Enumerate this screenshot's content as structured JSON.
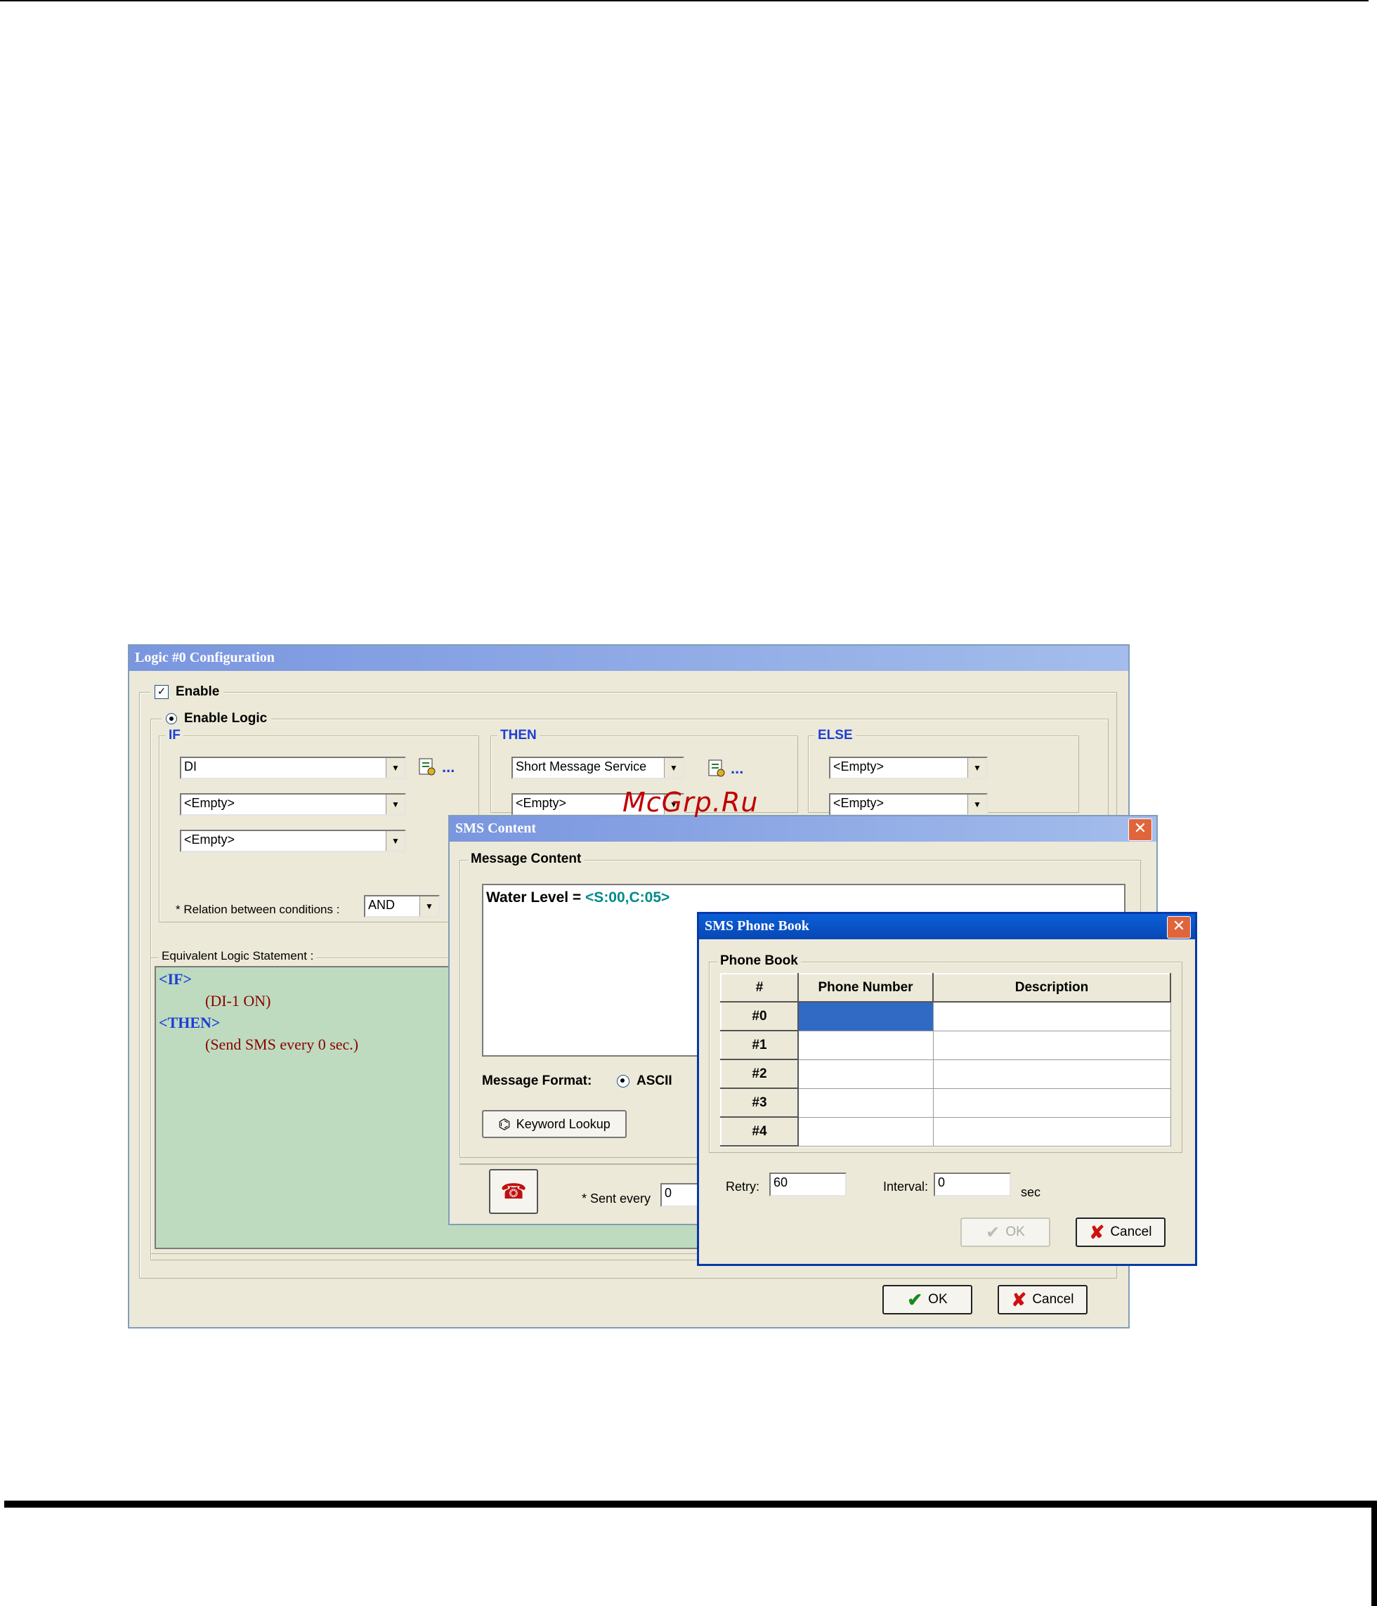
{
  "watermark": "McGrp.Ru",
  "logic_window": {
    "title": "Logic #0 Configuration",
    "enable_label": "Enable",
    "enable_logic_label": "Enable Logic",
    "if_group": {
      "legend": "IF",
      "combos": [
        "DI",
        "<Empty>",
        "<Empty>"
      ],
      "dots": "..."
    },
    "then_group": {
      "legend": "THEN",
      "combos": [
        "Short Message Service",
        "<Empty>"
      ],
      "dots": "..."
    },
    "else_group": {
      "legend": "ELSE",
      "combos": [
        "<Empty>",
        "<Empty>"
      ]
    },
    "relation_label": "* Relation between conditions :",
    "relation_value": "AND",
    "equivalent_legend": "Equivalent Logic Statement :",
    "statement": {
      "if_tag": "<IF>",
      "if_body": "(DI-1 ON)",
      "then_tag": "<THEN>",
      "then_body": "(Send SMS every 0 sec.)"
    },
    "ok_label": "OK",
    "cancel_label": "Cancel"
  },
  "sms_content_window": {
    "title": "SMS Content",
    "close_glyph": "✕",
    "message_legend": "Message Content",
    "message_prefix": "Water Level = ",
    "message_token": "<S:00,C:05>",
    "format_label": "Message Format:",
    "format_option": "ASCII",
    "keyword_button": "Keyword Lookup",
    "sent_every_label": "* Sent every",
    "sent_every_value": "0"
  },
  "phonebook_window": {
    "title": "SMS Phone Book",
    "close_glyph": "✕",
    "legend": "Phone Book",
    "columns": [
      "#",
      "Phone Number",
      "Description"
    ],
    "rows": [
      {
        "id": "#0",
        "phone": "",
        "desc": ""
      },
      {
        "id": "#1",
        "phone": "",
        "desc": ""
      },
      {
        "id": "#2",
        "phone": "",
        "desc": ""
      },
      {
        "id": "#3",
        "phone": "",
        "desc": ""
      },
      {
        "id": "#4",
        "phone": "",
        "desc": ""
      }
    ],
    "selected_row": 0,
    "retry_label": "Retry:",
    "retry_value": "60",
    "interval_label": "Interval:",
    "interval_value": "0",
    "sec_label": "sec",
    "ok_label": "OK",
    "cancel_label": "Cancel"
  },
  "colors": {
    "dialog_bg": "#ece9d8",
    "statement_bg": "#bedbbf",
    "keyword_blue": "#1e3ed6",
    "statement_red": "#8b0000",
    "token_teal": "#008b8b",
    "selection_blue": "#316ac5",
    "watermark_red": "#c00000"
  }
}
